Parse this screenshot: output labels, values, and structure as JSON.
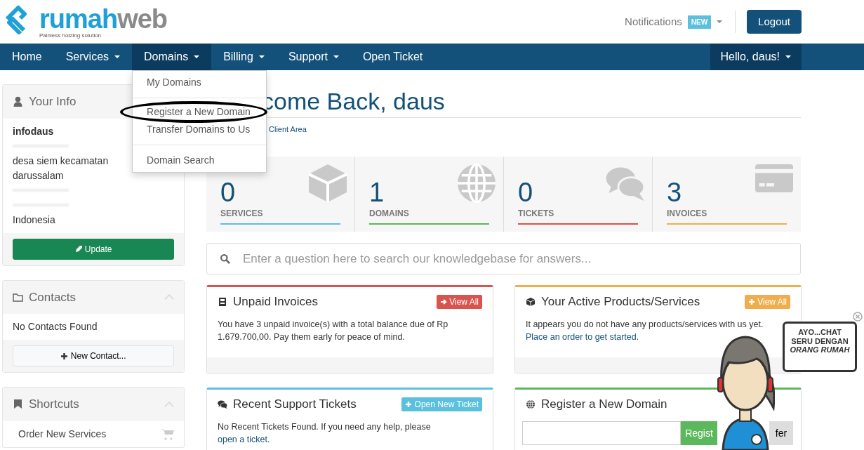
{
  "brand": {
    "parts": [
      {
        "text": "rumah",
        "color": "#1ea0d8"
      },
      {
        "text": "web",
        "color": "#8a8a8a"
      }
    ],
    "tagline": "Painless hosting solution"
  },
  "header": {
    "notifications": "Notifications",
    "badge": "NEW",
    "logout": "Logout"
  },
  "nav": {
    "items": [
      {
        "label": "Home",
        "dropdown": false,
        "selected": false
      },
      {
        "label": "Services",
        "dropdown": true,
        "selected": false
      },
      {
        "label": "Domains",
        "dropdown": true,
        "selected": true
      },
      {
        "label": "Billing",
        "dropdown": true,
        "selected": false
      },
      {
        "label": "Support",
        "dropdown": true,
        "selected": false
      },
      {
        "label": "Open Ticket",
        "dropdown": false,
        "selected": false
      }
    ],
    "user": "Hello, daus!"
  },
  "dropdown": {
    "items": [
      {
        "kind": "item",
        "label": "My Domains",
        "circled": false
      },
      {
        "kind": "divider"
      },
      {
        "kind": "item",
        "label": "Register a New Domain",
        "circled": true
      },
      {
        "kind": "item",
        "label": "Transfer Domains to Us",
        "circled": false
      },
      {
        "kind": "divider"
      },
      {
        "kind": "item",
        "label": "Domain Search",
        "circled": false
      }
    ]
  },
  "sidebar": [
    {
      "title": "Your Info",
      "collapsible": false,
      "lines": [
        {
          "kind": "name",
          "text": "infodaus"
        },
        {
          "kind": "redacted"
        },
        {
          "kind": "line",
          "text": "desa siem kecamatan"
        },
        {
          "kind": "line",
          "text": "darussalam"
        },
        {
          "kind": "redacted"
        },
        {
          "kind": "redacted"
        },
        {
          "kind": "line",
          "text": "Indonesia"
        }
      ],
      "button": {
        "label": "Update",
        "kind": "success"
      }
    },
    {
      "title": "Contacts",
      "collapsible": true,
      "lines": [
        {
          "kind": "line",
          "text": "No Contacts Found"
        }
      ],
      "button": {
        "label": "New Contact...",
        "kind": "default"
      }
    },
    {
      "title": "Shortcuts",
      "collapsible": true,
      "links": [
        {
          "label": "Order New Services"
        }
      ]
    }
  ],
  "main": {
    "title": "come Back, daus",
    "breadcrumb": "Client Area",
    "stats": [
      {
        "count": "0",
        "label": "SERVICES",
        "color": "#5bc0de"
      },
      {
        "count": "1",
        "label": "DOMAINS",
        "color": "#5cb85c"
      },
      {
        "count": "0",
        "label": "TICKETS",
        "color": "#d9534f"
      },
      {
        "count": "3",
        "label": "INVOICES",
        "color": "#f0ad4e"
      }
    ],
    "search": {
      "placeholder": "Enter a question here to search our knowledgebase for answers..."
    },
    "panels": [
      {
        "title": "Unpaid Invoices",
        "color": "#d9534f",
        "button": {
          "label": "View All"
        },
        "text": "You have 3 unpaid invoice(s) with a total balance due of Rp 1.679.700,00. Pay them early for peace of mind.",
        "footer": true
      },
      {
        "title": "Your Active Products/Services",
        "color": "#f0ad4e",
        "button": {
          "label": "View All"
        },
        "text": "It appears you do not have any products/services with us yet.",
        "link": "Place an order to get started.",
        "footer": true
      },
      {
        "title": "Recent Support Tickets",
        "color": "#5bc0de",
        "button": {
          "label": "Open New Ticket"
        },
        "text": "No Recent Tickets Found. If you need any help, please",
        "link": "open a ticket.",
        "footer": false
      },
      {
        "title": "Register a New Domain",
        "color": "#5cb85c",
        "domain_form": {
          "register": "Regist",
          "transfer": "fer"
        },
        "footer": false
      }
    ]
  },
  "chat": {
    "bubble": [
      "AYO...CHAT",
      "SERU DENGAN",
      "*ORANG RUMAH*"
    ]
  }
}
